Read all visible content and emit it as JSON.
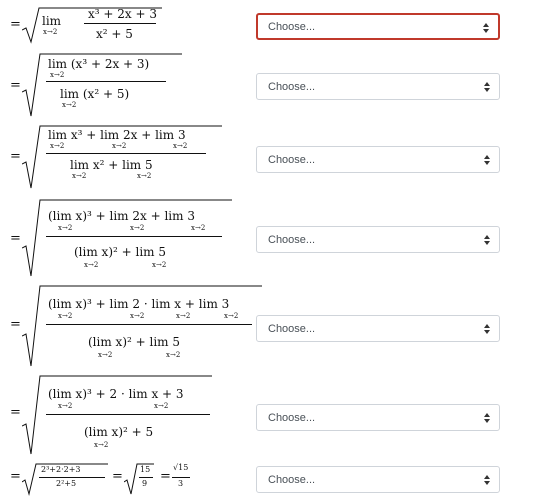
{
  "steps": [
    {
      "select": {
        "value": "Choose...",
        "focused": true
      }
    },
    {
      "select": {
        "value": "Choose...",
        "focused": false
      }
    },
    {
      "select": {
        "value": "Choose...",
        "focused": false
      }
    },
    {
      "select": {
        "value": "Choose...",
        "focused": false
      }
    },
    {
      "select": {
        "value": "Choose...",
        "focused": false
      }
    },
    {
      "select": {
        "value": "Choose...",
        "focused": false
      }
    },
    {
      "select": {
        "value": "Choose...",
        "focused": false
      }
    }
  ],
  "math": {
    "eq": "=",
    "lim": "lim",
    "sub": "x→2",
    "s1_num": "x³ + 2x + 3",
    "s1_den": "x² + 5",
    "s2_num": "lim (x³ + 2x + 3)",
    "s2_den": "lim (x² + 5)",
    "s3_num": "lim x³ + lim 2x + lim 3",
    "s3_den": "lim x² + lim 5",
    "s4_num": "(lim x)³ + lim 2x + lim 3",
    "s4_den": "(lim x)² + lim 5",
    "s5_num": "(lim x)³ + lim 2 · lim x + lim 3",
    "s5_den": "(lim x)² + lim 5",
    "s6_num": "(lim x)³ + 2 · lim x + 3",
    "s6_den": "(lim x)² + 5",
    "s7_a_num": "2³+2·2+3",
    "s7_a_den": "2²+5",
    "s7_b_num": "15",
    "s7_b_den": "9",
    "s7_c_num": "√15",
    "s7_c_den": "3"
  }
}
